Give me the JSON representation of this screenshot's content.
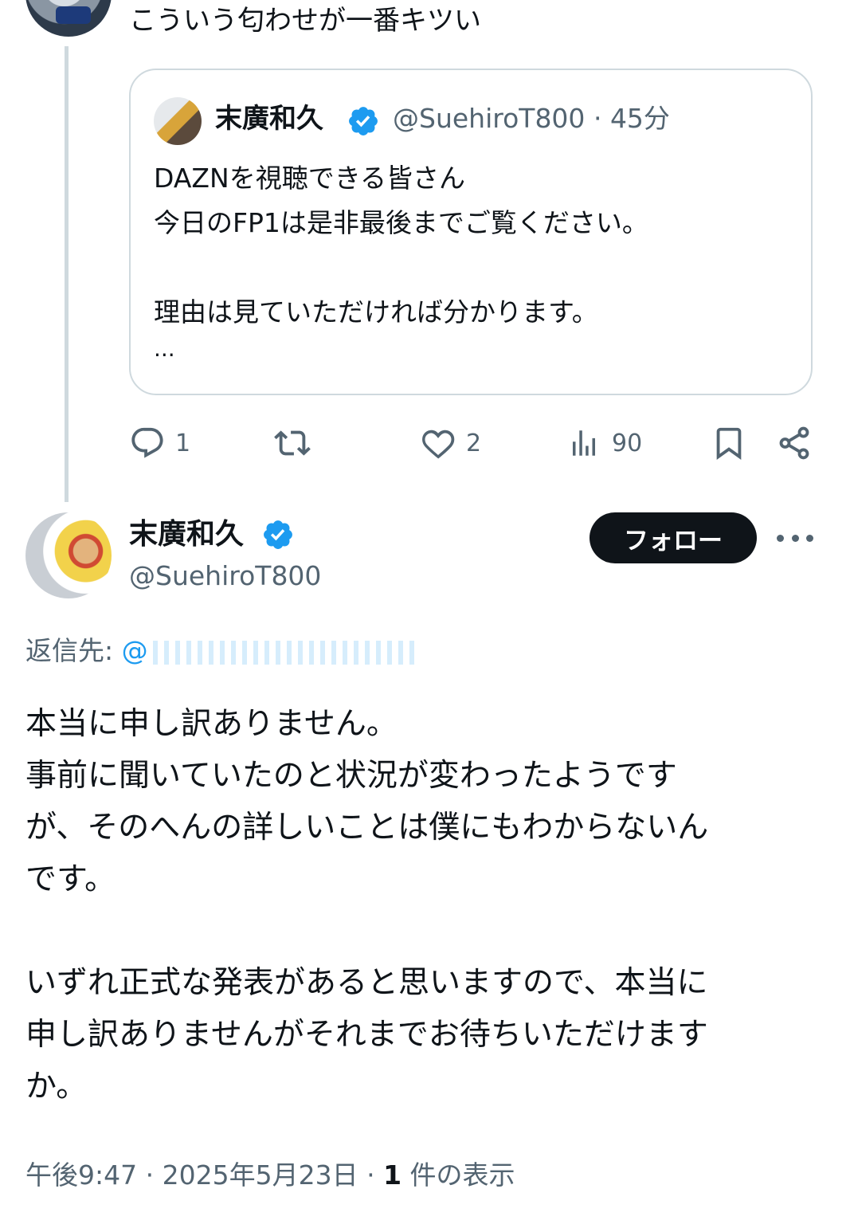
{
  "previous_tweet": {
    "text": "こういう匂わせが一番キツい"
  },
  "quoted_tweet": {
    "name": "末廣和久",
    "handle": "@SuehiroT800",
    "time": "45分",
    "separator": "·",
    "body": "DAZNを視聴できる皆さん\n今日のFP1は是非最後までご覧ください。\n\n理由は見ていただければ分かります。",
    "more": "..."
  },
  "actions": {
    "reply": {
      "icon": "reply-icon",
      "count": "1"
    },
    "retweet": {
      "icon": "retweet-icon",
      "count": ""
    },
    "like": {
      "icon": "heart-icon",
      "count": "2"
    },
    "views": {
      "icon": "views-icon",
      "count": "90"
    },
    "bookmark": {
      "icon": "bookmark-icon"
    },
    "share": {
      "icon": "share-icon"
    }
  },
  "main_tweet": {
    "name": "末廣和久",
    "handle": "@SuehiroT800",
    "follow_label": "フォロー",
    "reply_to_label": "返信先: ",
    "reply_to_handle": "@",
    "body": "本当に申し訳ありません。\n事前に聞いていたのと状況が変わったようです\nが、そのへんの詳しいことは僕にもわからないん\nです。\n\nいずれ正式な発表があると思いますので、本当に\n申し訳ありませんがそれまでお待ちいただけます\nか。",
    "time": "午後9:47",
    "date": "2025年5月23日",
    "views_count": "1",
    "views_label": " 件の表示"
  },
  "colors": {
    "text": "#0f1419",
    "secondary": "#536471",
    "accent": "#1d9bf0",
    "border": "#cfd9de",
    "button_bg": "#0f1419"
  }
}
